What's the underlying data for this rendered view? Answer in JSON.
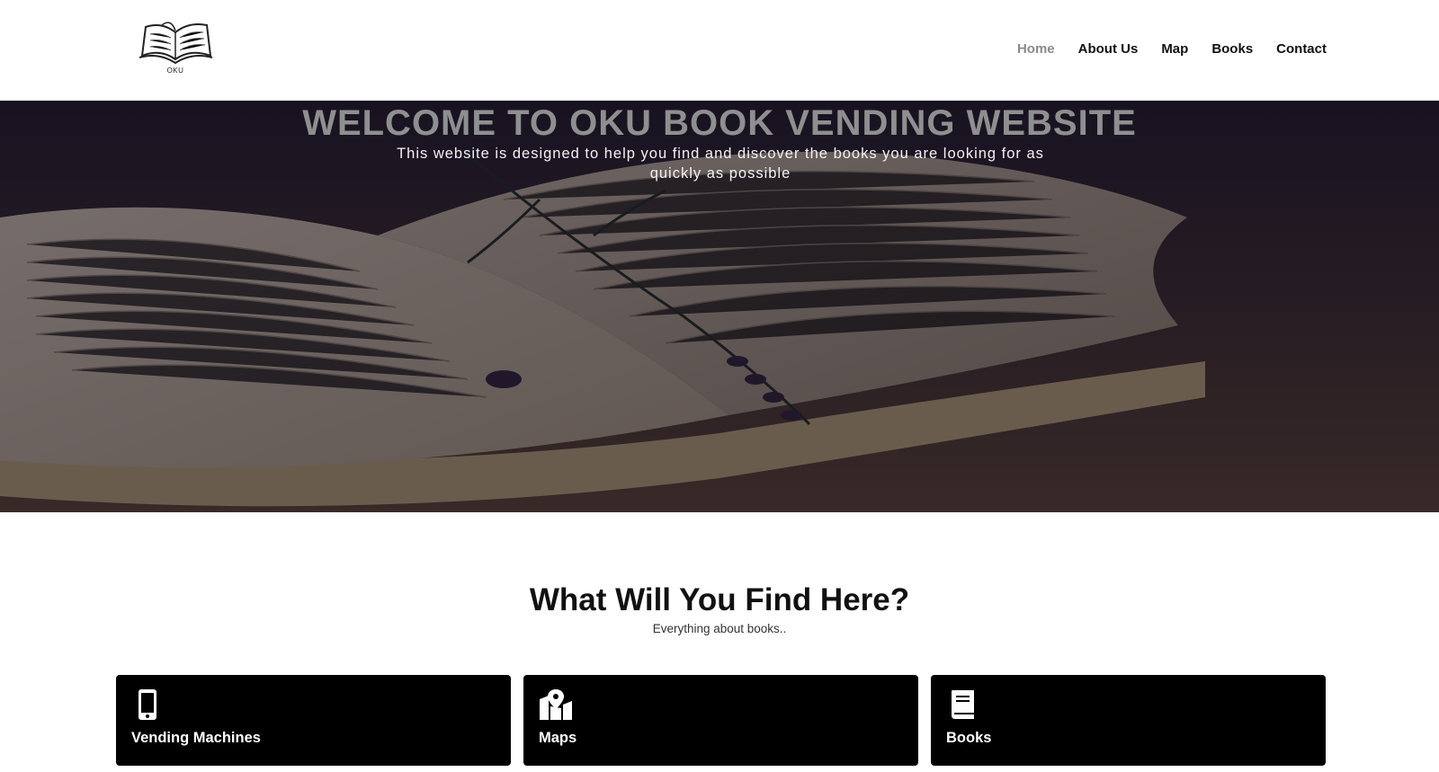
{
  "header": {
    "logo_text": "OKU",
    "nav": [
      {
        "label": "Home",
        "active": true
      },
      {
        "label": "About Us",
        "active": false
      },
      {
        "label": "Map",
        "active": false
      },
      {
        "label": "Books",
        "active": false
      },
      {
        "label": "Contact",
        "active": false
      }
    ]
  },
  "hero": {
    "title": "WELCOME TO OKU BOOK VENDING WEBSITE",
    "subtitle": "This website is designed to help you find and discover the books you are looking for as quickly as possible"
  },
  "section": {
    "title": "What Will You Find Here?",
    "subtitle": "Everything about books.."
  },
  "cards": [
    {
      "label": "Vending Machines",
      "icon": "mobile-phone-icon"
    },
    {
      "label": "Maps",
      "icon": "map-marker-icon"
    },
    {
      "label": "Books",
      "icon": "book-icon"
    }
  ],
  "colors": {
    "nav_active": "#8a8a8a",
    "hero_title": "#8f8f8f",
    "card_background": "#000000"
  }
}
